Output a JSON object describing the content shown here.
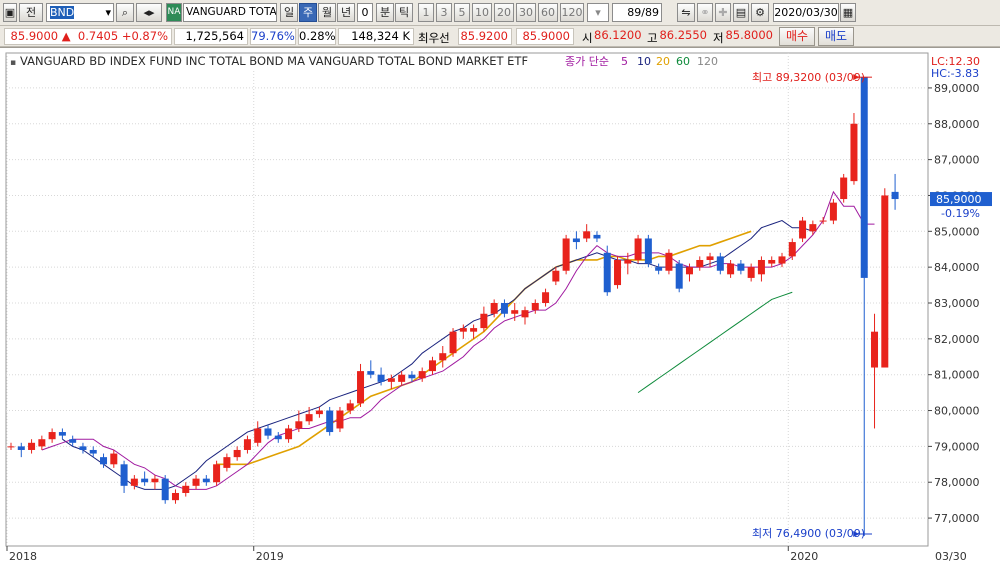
{
  "toolbar": {
    "left_label": "전",
    "code": "BND",
    "ticker_tag": "NA",
    "name": "VANGUARD TOTAL B",
    "periods": [
      "일",
      "주",
      "월",
      "년"
    ],
    "active_period": "주",
    "intervals": [
      "0",
      "분",
      "틱"
    ],
    "minute_options": [
      "1",
      "3",
      "5",
      "10",
      "20",
      "30",
      "60",
      "120"
    ],
    "count": "89/89",
    "date": "2020/03/30"
  },
  "quote": {
    "price": "85.9000",
    "change_arrow": "▲",
    "change": "0.7405",
    "change_pct": "+0.87%",
    "volume": "1,725,564",
    "vol_ratio": "79.76%",
    "turnover": "0.28%",
    "value": "148,324",
    "value_unit": "K",
    "best_label": "최우선",
    "best_bid": "85.9200",
    "best_ask": "85.9000",
    "open_label": "시",
    "open": "86.1200",
    "high_label": "고",
    "high": "86.2550",
    "low_label": "저",
    "low": "85.8000",
    "buy_button": "매수",
    "sell_button": "매도"
  },
  "chart_data": {
    "type": "candlestick",
    "title": "VANGUARD BD INDEX FUND INC TOTAL BOND MA  VANGUARD TOTAL BOND MARKET ETF",
    "ma_legend": {
      "label": "종가 단순",
      "periods": [
        "5",
        "10",
        "20",
        "60",
        "120"
      ],
      "colors": [
        "#a01aa0",
        "#1a237e",
        "#e0a000",
        "#0d8a3a",
        "#888888"
      ]
    },
    "lc_label": "LC:12.30",
    "hc_label": "HC:-3.83",
    "y_ticks": [
      77,
      78,
      79,
      80,
      81,
      82,
      83,
      84,
      85,
      86,
      87,
      88,
      89
    ],
    "y_tick_labels": [
      "77,0000",
      "78,0000",
      "79,0000",
      "80,0000",
      "81,0000",
      "82,0000",
      "83,0000",
      "84,0000",
      "85,0000",
      "86,0000",
      "87,0000",
      "88,0000",
      "89,0000"
    ],
    "ylim": [
      76.5,
      89.5
    ],
    "x_labels": [
      "2018",
      "2019",
      "2020",
      "03/30"
    ],
    "current_price_label": "85,9000",
    "current_change_label": "-0.19%",
    "max_annotation": "최고 89,3200 (03/09)",
    "min_annotation": "최저 76,4900 (03/09)",
    "up_color": "#e8231c",
    "down_color": "#1f5fcf",
    "candles": [
      [
        79.0,
        79.1,
        78.9,
        79.0
      ],
      [
        79.0,
        79.1,
        78.7,
        78.9
      ],
      [
        78.9,
        79.2,
        78.8,
        79.1
      ],
      [
        79.0,
        79.3,
        78.9,
        79.2
      ],
      [
        79.2,
        79.5,
        79.1,
        79.4
      ],
      [
        79.4,
        79.5,
        79.2,
        79.3
      ],
      [
        79.2,
        79.3,
        79.0,
        79.1
      ],
      [
        79.0,
        79.1,
        78.8,
        78.9
      ],
      [
        78.9,
        79.0,
        78.7,
        78.8
      ],
      [
        78.7,
        78.8,
        78.4,
        78.5
      ],
      [
        78.5,
        78.9,
        78.4,
        78.8
      ],
      [
        78.5,
        78.6,
        77.7,
        77.9
      ],
      [
        77.9,
        78.2,
        77.8,
        78.1
      ],
      [
        78.1,
        78.3,
        77.9,
        78.0
      ],
      [
        78.0,
        78.2,
        77.8,
        78.1
      ],
      [
        78.1,
        78.2,
        77.4,
        77.5
      ],
      [
        77.5,
        77.8,
        77.4,
        77.7
      ],
      [
        77.7,
        78.0,
        77.6,
        77.9
      ],
      [
        77.9,
        78.2,
        77.8,
        78.1
      ],
      [
        78.1,
        78.2,
        77.9,
        78.0
      ],
      [
        78.0,
        78.6,
        77.9,
        78.5
      ],
      [
        78.4,
        78.8,
        78.3,
        78.7
      ],
      [
        78.7,
        79.0,
        78.6,
        78.9
      ],
      [
        78.9,
        79.3,
        78.8,
        79.2
      ],
      [
        79.1,
        79.7,
        79.0,
        79.5
      ],
      [
        79.5,
        79.6,
        79.2,
        79.3
      ],
      [
        79.3,
        79.4,
        79.1,
        79.2
      ],
      [
        79.2,
        79.6,
        79.1,
        79.5
      ],
      [
        79.5,
        80.0,
        79.4,
        79.7
      ],
      [
        79.7,
        80.1,
        79.6,
        79.9
      ],
      [
        79.9,
        80.1,
        79.8,
        80.0
      ],
      [
        80.0,
        80.1,
        79.3,
        79.4
      ],
      [
        79.5,
        80.1,
        79.4,
        80.0
      ],
      [
        80.0,
        80.3,
        79.9,
        80.2
      ],
      [
        80.2,
        81.3,
        80.1,
        81.1
      ],
      [
        81.1,
        81.4,
        80.9,
        81.0
      ],
      [
        81.0,
        81.2,
        80.7,
        80.8
      ],
      [
        80.8,
        81.0,
        80.6,
        80.9
      ],
      [
        80.8,
        81.1,
        80.7,
        81.0
      ],
      [
        81.0,
        81.1,
        80.8,
        80.9
      ],
      [
        80.9,
        81.2,
        80.8,
        81.1
      ],
      [
        81.1,
        81.5,
        81.0,
        81.4
      ],
      [
        81.4,
        81.8,
        81.2,
        81.6
      ],
      [
        81.6,
        82.3,
        81.5,
        82.2
      ],
      [
        82.2,
        82.4,
        82.0,
        82.3
      ],
      [
        82.2,
        82.4,
        82.0,
        82.3
      ],
      [
        82.3,
        82.9,
        82.2,
        82.7
      ],
      [
        82.7,
        83.1,
        82.6,
        83.0
      ],
      [
        83.0,
        83.1,
        82.6,
        82.7
      ],
      [
        82.7,
        83.0,
        82.5,
        82.8
      ],
      [
        82.6,
        82.9,
        82.4,
        82.8
      ],
      [
        82.8,
        83.1,
        82.7,
        83.0
      ],
      [
        83.0,
        83.4,
        82.9,
        83.3
      ],
      [
        83.6,
        84.0,
        83.5,
        83.9
      ],
      [
        83.9,
        84.9,
        83.8,
        84.8
      ],
      [
        84.8,
        85.0,
        84.5,
        84.7
      ],
      [
        84.8,
        85.2,
        84.7,
        85.0
      ],
      [
        84.9,
        85.0,
        84.7,
        84.8
      ],
      [
        84.4,
        84.6,
        83.2,
        83.3
      ],
      [
        83.5,
        84.3,
        83.4,
        84.2
      ],
      [
        84.1,
        84.4,
        83.8,
        84.2
      ],
      [
        84.2,
        84.9,
        84.1,
        84.8
      ],
      [
        84.8,
        84.9,
        84.0,
        84.1
      ],
      [
        84.0,
        84.1,
        83.8,
        83.9
      ],
      [
        83.9,
        84.5,
        83.8,
        84.4
      ],
      [
        84.1,
        84.2,
        83.3,
        83.4
      ],
      [
        83.8,
        84.1,
        83.6,
        84.0
      ],
      [
        84.0,
        84.3,
        83.9,
        84.2
      ],
      [
        84.2,
        84.4,
        84.0,
        84.3
      ],
      [
        84.3,
        84.4,
        83.8,
        83.9
      ],
      [
        83.8,
        84.2,
        83.7,
        84.1
      ],
      [
        84.1,
        84.2,
        83.8,
        83.9
      ],
      [
        83.7,
        84.1,
        83.6,
        84.0
      ],
      [
        83.8,
        84.3,
        83.6,
        84.2
      ],
      [
        84.1,
        84.3,
        84.0,
        84.2
      ],
      [
        84.1,
        84.4,
        84.0,
        84.3
      ],
      [
        84.3,
        84.8,
        84.2,
        84.7
      ],
      [
        84.8,
        85.4,
        84.7,
        85.3
      ],
      [
        85.0,
        85.3,
        84.9,
        85.2
      ],
      [
        85.3,
        85.4,
        85.2,
        85.3
      ],
      [
        85.3,
        85.9,
        85.2,
        85.8
      ],
      [
        85.9,
        86.6,
        85.8,
        86.5
      ],
      [
        86.4,
        88.3,
        86.3,
        88.0
      ],
      [
        89.3,
        89.3,
        76.5,
        83.7
      ],
      [
        81.2,
        82.7,
        79.5,
        82.2
      ],
      [
        81.2,
        86.2,
        81.2,
        86.0
      ],
      [
        86.1,
        86.6,
        85.6,
        85.9
      ]
    ],
    "ma5_start": 3,
    "ma5": [
      78.9,
      79.0,
      79.1,
      79.2,
      79.2,
      79.2,
      79.0,
      78.9,
      78.7,
      78.5,
      78.4,
      78.2,
      78.1,
      77.9,
      77.8,
      77.8,
      77.8,
      77.9,
      78.1,
      78.3,
      78.5,
      78.8,
      79.1,
      79.3,
      79.4,
      79.5,
      79.5,
      79.6,
      79.7,
      79.7,
      79.8,
      79.8,
      80.0,
      80.3,
      80.5,
      80.7,
      80.8,
      80.9,
      81.0,
      81.1,
      81.3,
      81.5,
      81.8,
      82.0,
      82.3,
      82.5,
      82.6,
      82.7,
      82.8,
      82.8,
      83.0,
      83.4,
      83.9,
      84.3,
      84.6,
      84.4,
      84.3,
      84.3,
      84.4,
      84.4,
      84.4,
      84.3,
      84.1,
      84.0,
      84.0,
      84.0,
      84.1,
      84.1,
      84.0,
      84.0,
      84.0,
      84.0,
      84.1,
      84.3,
      84.6,
      84.9,
      85.3,
      86.1,
      85.7,
      85.7,
      85.2,
      85.2
    ],
    "ma10_start": 5,
    "ma10": [
      79.2,
      79.0,
      78.9,
      78.7,
      78.5,
      78.3,
      78.1,
      77.9,
      77.8,
      77.8,
      77.8,
      77.9,
      78.1,
      78.3,
      78.6,
      78.8,
      79.0,
      79.2,
      79.4,
      79.5,
      79.6,
      79.7,
      79.8,
      79.9,
      80.0,
      80.1,
      80.3,
      80.4,
      80.5,
      80.6,
      80.7,
      80.8,
      80.9,
      81.1,
      81.3,
      81.6,
      81.8,
      82.0,
      82.2,
      82.3,
      82.5,
      82.6,
      82.7,
      82.9,
      83.1,
      83.4,
      83.6,
      83.8,
      84.0,
      84.1,
      84.2,
      84.3,
      84.4,
      84.3,
      84.2,
      84.2,
      84.1,
      84.1,
      84.0,
      84.0,
      84.0,
      84.0,
      84.0,
      84.1,
      84.2,
      84.4,
      84.6,
      84.8,
      85.1,
      85.2,
      85.3,
      85.1,
      85.1,
      85.0
    ],
    "ma20_start": 20,
    "ma20": [
      78.5,
      78.5,
      78.5,
      78.5,
      78.6,
      78.7,
      78.8,
      78.9,
      79.0,
      79.2,
      79.4,
      79.6,
      79.8,
      80.0,
      80.2,
      80.4,
      80.5,
      80.6,
      80.7,
      80.8,
      81.0,
      81.2,
      81.4,
      81.6,
      81.8,
      82.0,
      82.2,
      82.5,
      82.8,
      83.1,
      83.4,
      83.6,
      83.8,
      84.0,
      84.1,
      84.2,
      84.2,
      84.2,
      84.3,
      84.3,
      84.2,
      84.2,
      84.2,
      84.3,
      84.3,
      84.4,
      84.5,
      84.6,
      84.6,
      84.7,
      84.8,
      84.9,
      85.0
    ],
    "ma60_start": 61,
    "ma60": [
      80.5,
      80.7,
      80.9,
      81.1,
      81.3,
      81.5,
      81.7,
      81.9,
      82.1,
      82.3,
      82.5,
      82.7,
      82.9,
      83.1,
      83.2,
      83.3
    ]
  }
}
